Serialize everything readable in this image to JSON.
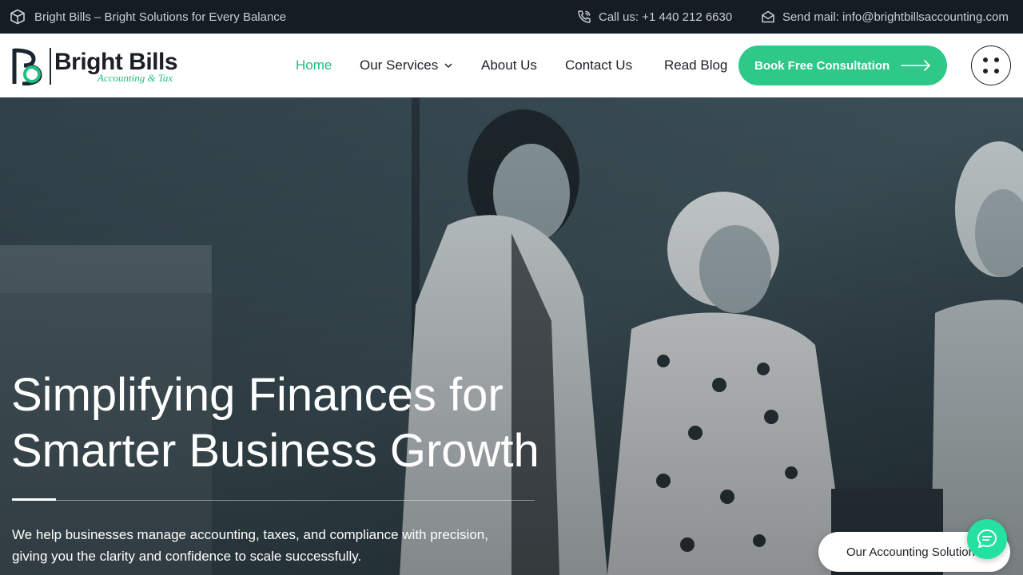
{
  "topbar": {
    "tagline": "Bright Bills – Bright Solutions for Every Balance",
    "tagline_icon": "cube-icon",
    "phone_text": "Call us: +1 440 212 6630",
    "phone_icon": "phone-icon",
    "mail_text": "Send mail: info@brightbillsaccounting.com",
    "mail_icon": "envelope-icon"
  },
  "header": {
    "logo": {
      "brand": "Bright Bills",
      "tag": "Accounting & Tax"
    },
    "nav": [
      {
        "label": "Home",
        "active": true
      },
      {
        "label": "Our Services",
        "has_dropdown": true
      },
      {
        "label": "About Us"
      },
      {
        "label": "Contact Us"
      },
      {
        "label": "Read Blog"
      }
    ],
    "cta_label": "Book Free Consultation",
    "cta_icon": "arrow-right-icon",
    "menu_icon": "dots-grid-icon"
  },
  "hero": {
    "title_line1": "Simplifying Finances for",
    "title_line2": "Smarter Business Growth",
    "subtitle_line1": "We help businesses manage accounting, taxes, and compliance with precision,",
    "subtitle_line2": "giving you the clarity and confidence to scale successfully."
  },
  "widgets": {
    "solutions_label": "Our Accounting Solutions",
    "chat_icon": "chat-bubble-icon"
  },
  "colors": {
    "accent": "#2ec889",
    "topbar_bg": "#141c24",
    "text_dark": "#1b1f26"
  }
}
